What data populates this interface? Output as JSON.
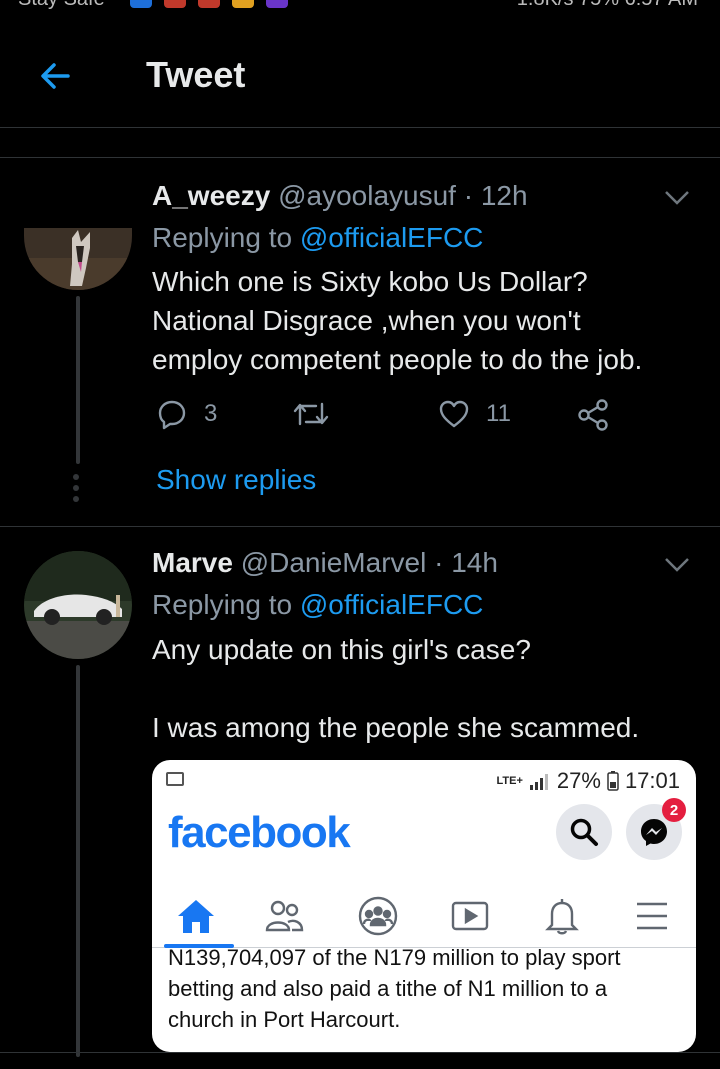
{
  "status_bar": {
    "left_text": "Stay Safe",
    "right_text": "1.8K/s  75%  6:57 AM"
  },
  "header": {
    "title": "Tweet"
  },
  "tweets": [
    {
      "name": "A_weezy",
      "handle": "@ayoolayusuf",
      "separator": "·",
      "time": "12h",
      "replying_prefix": "Replying to",
      "replying_to": "@officialEFCC",
      "text_lines": [
        "Which one is Sixty kobo Us Dollar?",
        "National Disgrace ,when you won't",
        "employ competent people to do the job."
      ],
      "replies": "3",
      "retweets": "",
      "likes": "11",
      "show_replies": "Show replies"
    },
    {
      "name": "Marve",
      "handle": "@DanieMarvel",
      "separator": "·",
      "time": "14h",
      "replying_prefix": "Replying to",
      "replying_to": "@officialEFCC",
      "text_lines": [
        "Any update on this girl's case?",
        "",
        "I was among the people she scammed."
      ],
      "media": {
        "status_signal": "LTE+",
        "battery": "27%",
        "clock": "17:01",
        "app_logo": "facebook",
        "messenger_badge": "2",
        "article_lines": [
          "N139,704,097 of the N179 million to play sport",
          "betting and also paid a tithe of N1 million to a",
          "church in Port Harcourt."
        ]
      }
    }
  ],
  "colors": {
    "background": "#000000",
    "accent": "#1d9bf0",
    "secondary_text": "#8b98a5",
    "primary_text": "#e7e9ea",
    "divider": "#2f3336",
    "facebook_blue": "#1877f2"
  },
  "icons": [
    "back-arrow-icon",
    "caret-down-icon",
    "reply-icon",
    "retweet-icon",
    "like-icon",
    "share-icon",
    "image-icon",
    "search-icon",
    "messenger-icon",
    "home-icon",
    "friends-icon",
    "groups-icon",
    "watch-icon",
    "bell-icon",
    "menu-icon"
  ]
}
